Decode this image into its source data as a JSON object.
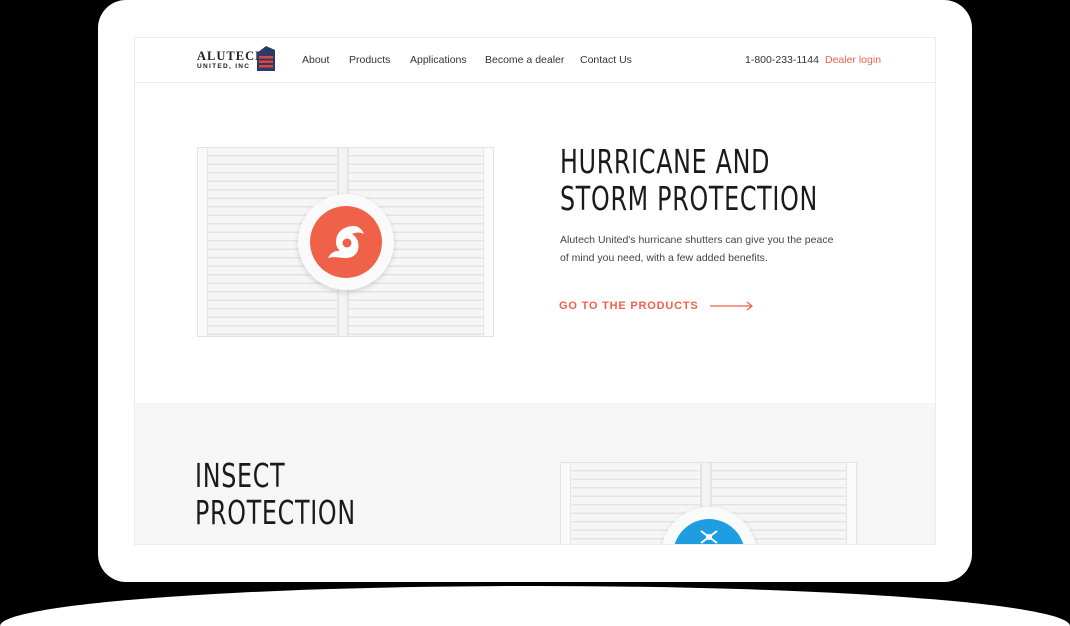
{
  "brand": {
    "name": "ALUTECH",
    "subname": "UNITED, INC"
  },
  "nav": {
    "links": [
      "About",
      "Products",
      "Applications",
      "Become a dealer",
      "Contact Us"
    ],
    "phone": "1-800-233-1144",
    "dealer_login": "Dealer login"
  },
  "hero": {
    "title_lines": [
      "HURRICANE AND",
      "STORM PROTECTION"
    ],
    "description": "Alutech United's hurricane shutters can give you the peace of mind you need, with a few added benefits.",
    "cta_label": "GO TO THE PRODUCTS",
    "icon": "hurricane-icon"
  },
  "section_two": {
    "title_lines": [
      "INSECT",
      "PROTECTION"
    ],
    "icon": "insect-icon"
  },
  "colors": {
    "accent": "#f0614a",
    "insect_accent": "#1e9ee0",
    "section_bg": "#f6f6f6"
  }
}
